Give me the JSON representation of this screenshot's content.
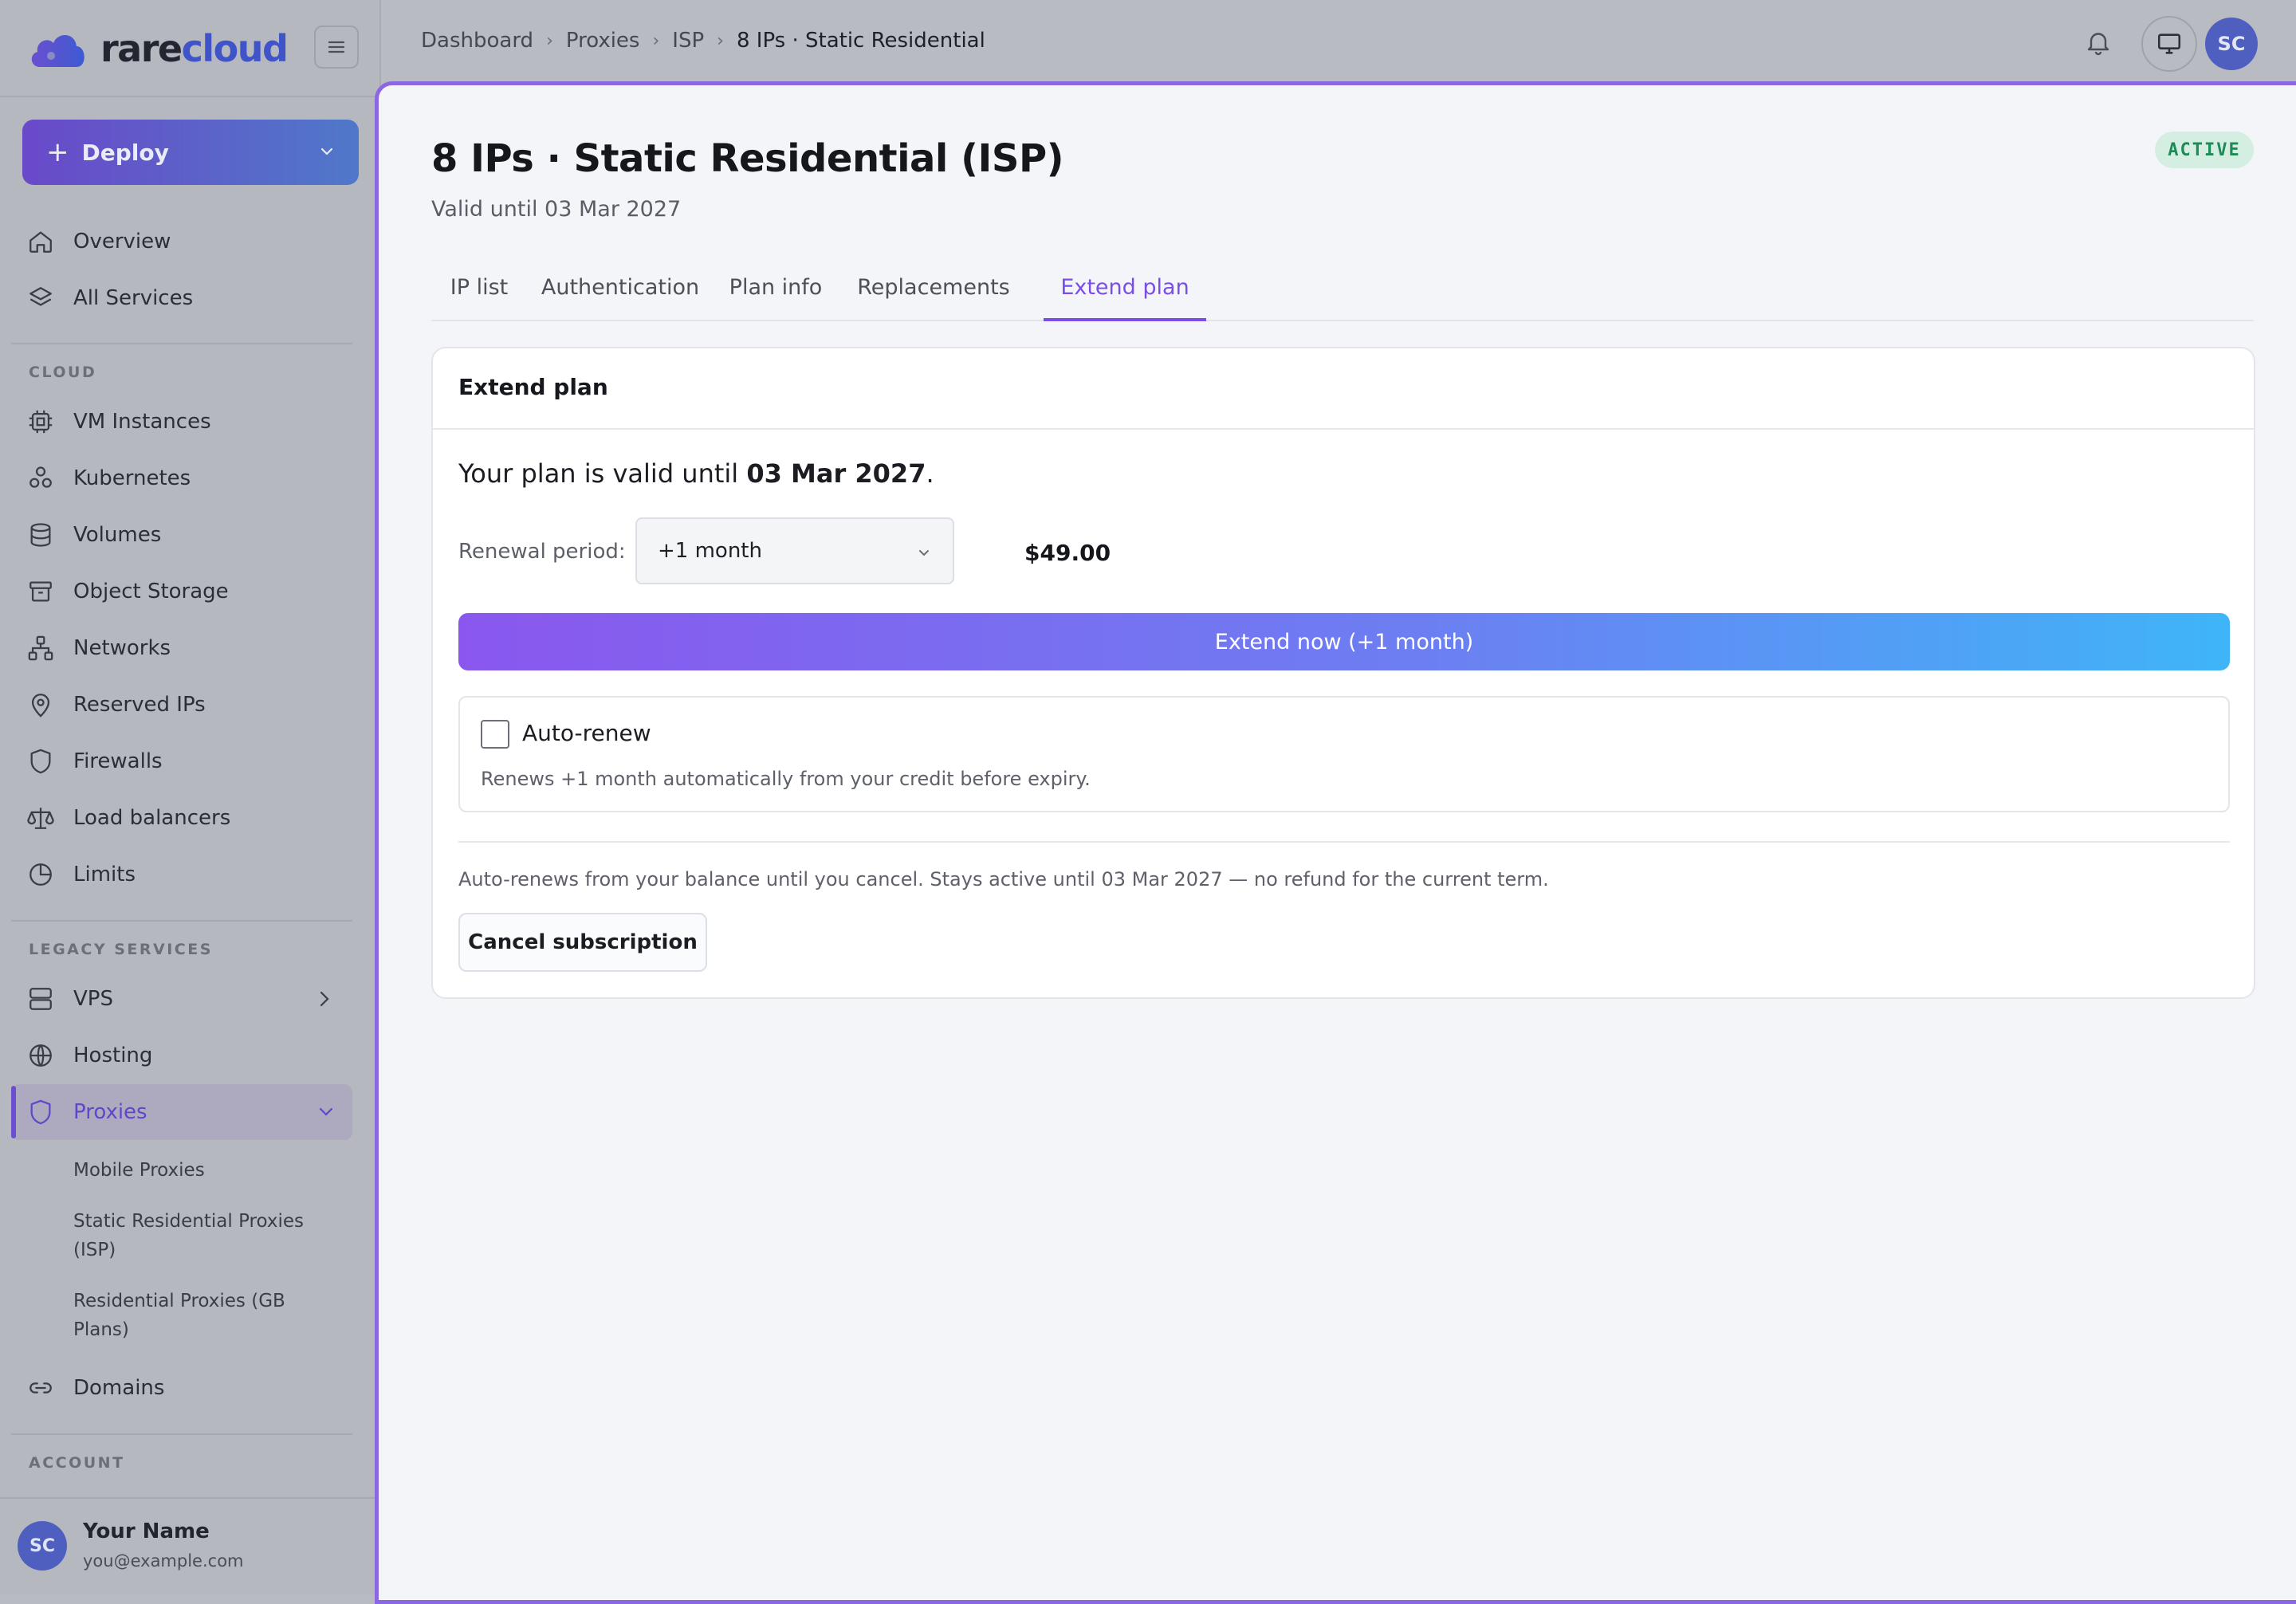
{
  "brand": {
    "part1": "rare",
    "part2": "cloud"
  },
  "sidebar": {
    "deploy_label": "Deploy",
    "nav_top": [
      {
        "label": "Overview",
        "icon": "home-icon"
      },
      {
        "label": "All Services",
        "icon": "layers-icon"
      }
    ],
    "cloud_label": "CLOUD",
    "cloud_items": [
      {
        "label": "VM Instances",
        "icon": "cpu-icon"
      },
      {
        "label": "Kubernetes",
        "icon": "kubernetes-icon"
      },
      {
        "label": "Volumes",
        "icon": "database-icon"
      },
      {
        "label": "Object Storage",
        "icon": "archive-icon"
      },
      {
        "label": "Networks",
        "icon": "network-icon"
      },
      {
        "label": "Reserved IPs",
        "icon": "map-pin-icon"
      },
      {
        "label": "Firewalls",
        "icon": "shield-icon"
      },
      {
        "label": "Load balancers",
        "icon": "scale-icon"
      },
      {
        "label": "Limits",
        "icon": "pie-chart-icon"
      }
    ],
    "legacy_label": "LEGACY SERVICES",
    "legacy_items": [
      {
        "label": "VPS",
        "icon": "server-icon"
      },
      {
        "label": "Hosting",
        "icon": "globe-icon"
      },
      {
        "label": "Proxies",
        "icon": "shield-icon"
      }
    ],
    "proxies_sub": [
      "Mobile Proxies",
      "Static Residential Proxies (ISP)",
      "Residential Proxies (GB Plans)"
    ],
    "domains_label": "Domains",
    "account_label": "ACCOUNT",
    "user": {
      "initials": "SC",
      "name": "Your Name",
      "email": "you@example.com"
    }
  },
  "breadcrumb": [
    "Dashboard",
    "Proxies",
    "ISP",
    "8 IPs · Static Residential"
  ],
  "topbar": {
    "avatar_initials": "SC"
  },
  "page": {
    "title": "8 IPs · Static Residential (ISP)",
    "subtitle": "Valid until 03 Mar 2027",
    "status": "ACTIVE"
  },
  "tabs": [
    "IP list",
    "Authentication",
    "Plan info",
    "Replacements",
    "Extend plan"
  ],
  "extend": {
    "card_title": "Extend plan",
    "valid_prefix": "Your plan is valid until ",
    "valid_date": "03 Mar 2027",
    "valid_suffix": ".",
    "renewal_label": "Renewal period:",
    "renewal_value": "+1 month",
    "price": "$49.00",
    "extend_button": "Extend now (+1 month)",
    "auto_renew_label": "Auto-renew",
    "auto_renew_checked": false,
    "auto_renew_help": "Renews +1 month automatically from your credit before expiry.",
    "cancel_note": "Auto-renews from your balance until you cancel. Stays active until 03 Mar 2027 — no refund for the current term.",
    "cancel_button": "Cancel subscription"
  },
  "colors": {
    "accent": "#7a4ee6",
    "success": "#1f8a57",
    "brand": "#3f54c9"
  }
}
